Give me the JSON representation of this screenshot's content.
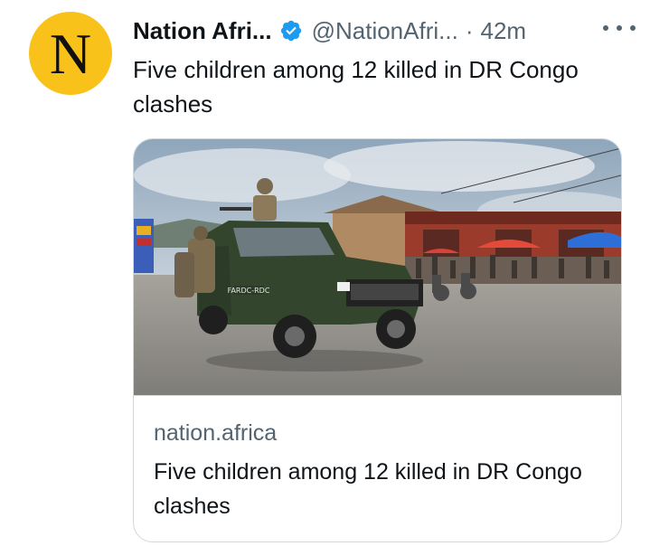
{
  "tweet": {
    "author": {
      "avatar_letter": "N",
      "display_name": "Nation Afri...",
      "handle": "@NationAfri...",
      "verified": true
    },
    "separator": "·",
    "time": "42m",
    "text": "Five children among 12 killed in DR Congo clashes",
    "more_icon": "more-horizontal-icon"
  },
  "card": {
    "image_alt": "Soldiers riding a green military pickup truck along a street",
    "truck_door_text": "FARDC-RDC",
    "domain": "nation.africa",
    "title": "Five children among 12 killed in DR Congo clashes"
  },
  "colors": {
    "avatar_bg": "#f9c21b",
    "verified": "#1d9bf0",
    "secondary_text": "#536471",
    "primary_text": "#0f1419",
    "border": "#cfd9de"
  }
}
